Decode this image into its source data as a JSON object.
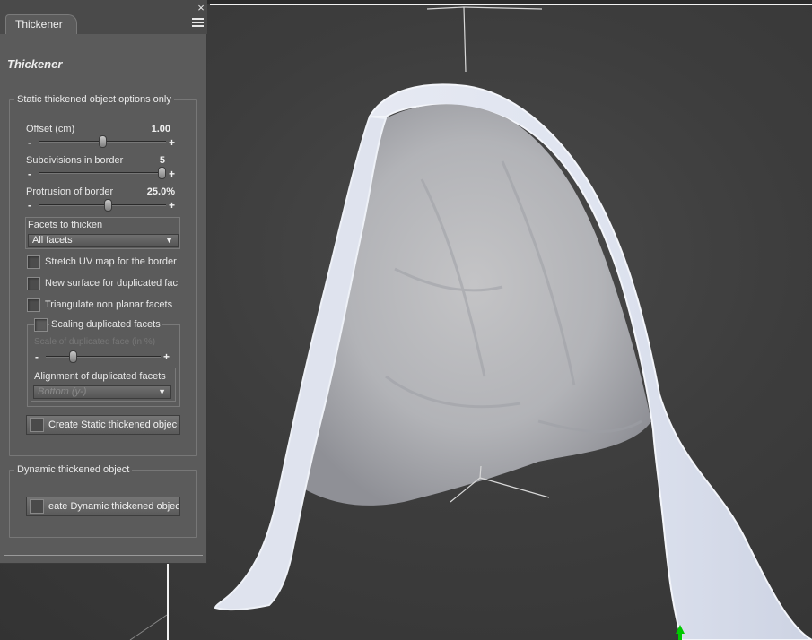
{
  "panel": {
    "tab_label": "Thickener",
    "close_glyph": "×",
    "title": "Thickener",
    "static_group": {
      "legend": "Static thickened object options only",
      "offset": {
        "label": "Offset (cm)",
        "value": "1.00",
        "level": 0.5
      },
      "subdivisions": {
        "label": "Subdivisions in border",
        "value": "5",
        "level": 1.0
      },
      "protrusion": {
        "label": "Protrusion of border",
        "value": "25.0%",
        "level": 0.55
      },
      "facets": {
        "legend": "Facets to thicken",
        "selected": "All facets"
      },
      "stretch_uv": {
        "label": "Stretch UV map for the border",
        "checked": false
      },
      "new_surface": {
        "label": "New surface for duplicated fac",
        "checked": false
      },
      "triangulate": {
        "label": "Triangulate non planar facets",
        "checked": false
      },
      "scaling": {
        "label": "Scaling duplicated facets",
        "checked": false,
        "scale_label": "Scale of duplicated face (in %)",
        "scale_level": 0.22,
        "alignment_label": "Alignment of duplicated facets",
        "alignment_selected": "Bottom (y-)"
      },
      "create_static_button": "Create Static thickened objec"
    },
    "dynamic_group": {
      "legend": "Dynamic thickened object",
      "create_dynamic_button": "eate Dynamic thickened objec"
    },
    "minus": "-",
    "plus": "+"
  },
  "viewport": {
    "background_color": "#3d3d3d",
    "cloth_color": "#dfe3ef",
    "axis_color": "#e0e0e0",
    "gizmo_color": "#00c800"
  }
}
